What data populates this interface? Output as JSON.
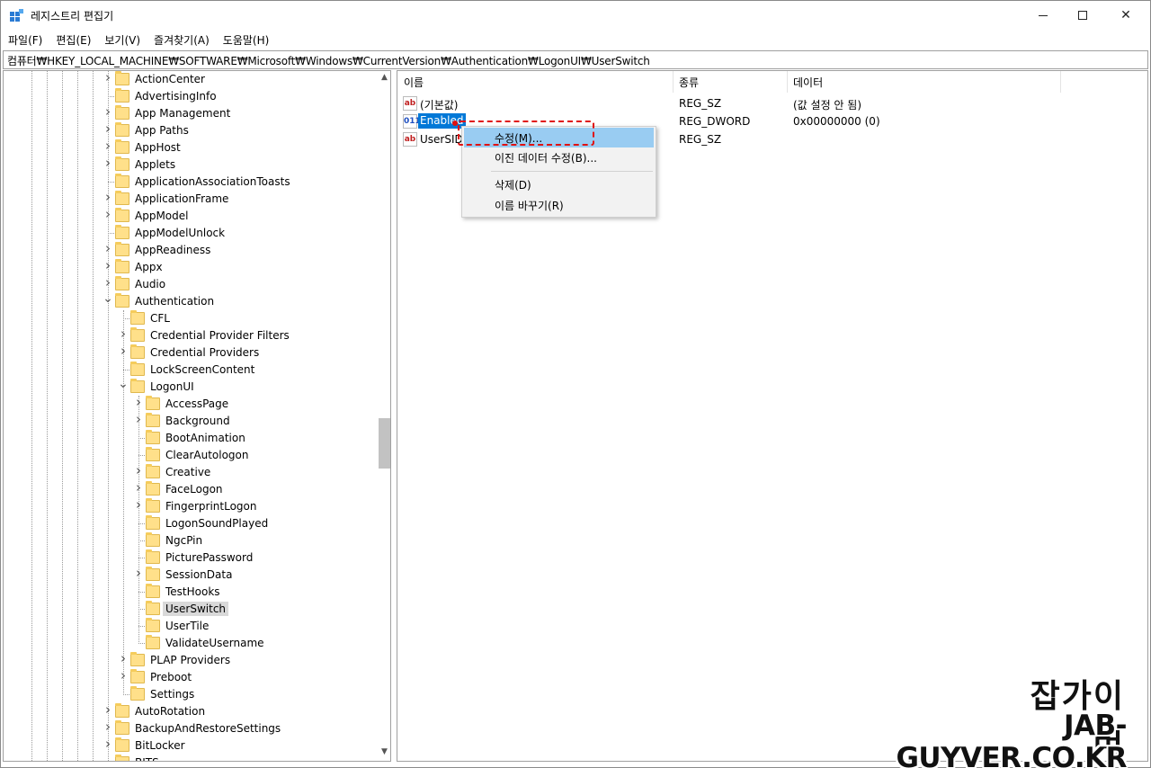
{
  "window": {
    "title": "레지스트리 편집기",
    "minimize": "",
    "maximize": "",
    "close": "✕"
  },
  "menu": [
    "파일(F)",
    "편집(E)",
    "보기(V)",
    "즐겨찾기(A)",
    "도움말(H)"
  ],
  "address": "컴퓨터₩HKEY_LOCAL_MACHINE₩SOFTWARE₩Microsoft₩Windows₩CurrentVersion₩Authentication₩LogonUI₩UserSwitch",
  "tree": [
    {
      "label": "ActionCenter",
      "level": 0,
      "expander": "collapsed"
    },
    {
      "label": "AdvertisingInfo",
      "level": 0,
      "expander": "none"
    },
    {
      "label": "App Management",
      "level": 0,
      "expander": "collapsed"
    },
    {
      "label": "App Paths",
      "level": 0,
      "expander": "collapsed"
    },
    {
      "label": "AppHost",
      "level": 0,
      "expander": "collapsed"
    },
    {
      "label": "Applets",
      "level": 0,
      "expander": "collapsed"
    },
    {
      "label": "ApplicationAssociationToasts",
      "level": 0,
      "expander": "none"
    },
    {
      "label": "ApplicationFrame",
      "level": 0,
      "expander": "collapsed"
    },
    {
      "label": "AppModel",
      "level": 0,
      "expander": "collapsed"
    },
    {
      "label": "AppModelUnlock",
      "level": 0,
      "expander": "none"
    },
    {
      "label": "AppReadiness",
      "level": 0,
      "expander": "collapsed"
    },
    {
      "label": "Appx",
      "level": 0,
      "expander": "collapsed"
    },
    {
      "label": "Audio",
      "level": 0,
      "expander": "collapsed"
    },
    {
      "label": "Authentication",
      "level": 0,
      "expander": "expanded"
    },
    {
      "label": "CFL",
      "level": 1,
      "expander": "none"
    },
    {
      "label": "Credential Provider Filters",
      "level": 1,
      "expander": "collapsed"
    },
    {
      "label": "Credential Providers",
      "level": 1,
      "expander": "collapsed"
    },
    {
      "label": "LockScreenContent",
      "level": 1,
      "expander": "none"
    },
    {
      "label": "LogonUI",
      "level": 1,
      "expander": "expanded"
    },
    {
      "label": "AccessPage",
      "level": 2,
      "expander": "collapsed"
    },
    {
      "label": "Background",
      "level": 2,
      "expander": "collapsed"
    },
    {
      "label": "BootAnimation",
      "level": 2,
      "expander": "none"
    },
    {
      "label": "ClearAutologon",
      "level": 2,
      "expander": "none"
    },
    {
      "label": "Creative",
      "level": 2,
      "expander": "collapsed"
    },
    {
      "label": "FaceLogon",
      "level": 2,
      "expander": "collapsed"
    },
    {
      "label": "FingerprintLogon",
      "level": 2,
      "expander": "collapsed"
    },
    {
      "label": "LogonSoundPlayed",
      "level": 2,
      "expander": "none"
    },
    {
      "label": "NgcPin",
      "level": 2,
      "expander": "none"
    },
    {
      "label": "PicturePassword",
      "level": 2,
      "expander": "none"
    },
    {
      "label": "SessionData",
      "level": 2,
      "expander": "collapsed"
    },
    {
      "label": "TestHooks",
      "level": 2,
      "expander": "none"
    },
    {
      "label": "UserSwitch",
      "level": 2,
      "expander": "none",
      "selected": true
    },
    {
      "label": "UserTile",
      "level": 2,
      "expander": "none"
    },
    {
      "label": "ValidateUsername",
      "level": 2,
      "expander": "none"
    },
    {
      "label": "PLAP Providers",
      "level": 1,
      "expander": "collapsed"
    },
    {
      "label": "Preboot",
      "level": 1,
      "expander": "collapsed"
    },
    {
      "label": "Settings",
      "level": 1,
      "expander": "none"
    },
    {
      "label": "AutoRotation",
      "level": 0,
      "expander": "collapsed"
    },
    {
      "label": "BackupAndRestoreSettings",
      "level": 0,
      "expander": "collapsed"
    },
    {
      "label": "BitLocker",
      "level": 0,
      "expander": "collapsed"
    },
    {
      "label": "BITS",
      "level": 0,
      "expander": "none"
    }
  ],
  "list": {
    "columns": [
      "이름",
      "종류",
      "데이터"
    ],
    "rows": [
      {
        "icon": "ab",
        "kind": "sz",
        "name": "(기본값)",
        "type": "REG_SZ",
        "data": "(값 설정 안 됨)"
      },
      {
        "icon": "011",
        "kind": "dword",
        "name": "Enabled",
        "type": "REG_DWORD",
        "data": "0x00000000 (0)",
        "selected": true
      },
      {
        "icon": "ab",
        "kind": "sz",
        "name": "UserSID",
        "type": "REG_SZ",
        "data": ""
      }
    ]
  },
  "context_menu": {
    "items": [
      {
        "label": "수정(M)...",
        "active": true
      },
      {
        "label": "이진 데이터 수정(B)..."
      },
      {
        "separator": true
      },
      {
        "label": "삭제(D)"
      },
      {
        "label": "이름 바꾸기(R)"
      }
    ]
  },
  "scrollbar": {
    "up": "▲",
    "down": "▼",
    "position_fraction": 0.5
  },
  "watermark": {
    "korean": "잡가이버",
    "domain": "JAB-GUYVER.CO.KR"
  },
  "colors": {
    "selection": "#0078d7",
    "menu_active": "#99ccf2",
    "highlight_box": "#e01010",
    "folder": "#ffe08a"
  }
}
